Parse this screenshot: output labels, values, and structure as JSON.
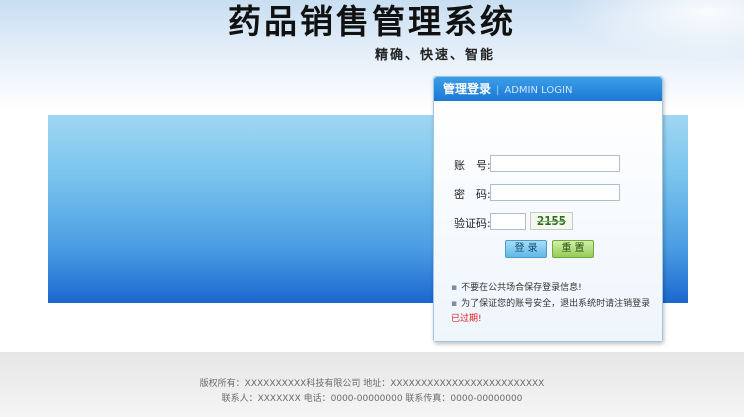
{
  "header": {
    "title": "药品销售管理系统",
    "slogan": "精确、快速、智能"
  },
  "login_panel": {
    "title": "管理登录",
    "separator": "|",
    "subtitle": "ADMIN LOGIN",
    "account_label": "账　号:",
    "account_value": "",
    "password_label": "密　码:",
    "password_value": "",
    "captcha_label": "验证码:",
    "captcha_value": "",
    "captcha_image_text": "2155",
    "login_button": "登录",
    "reset_button": "重置",
    "bullet": "▪",
    "notes": [
      "不要在公共场合保存登录信息!",
      "为了保证您的账号安全，退出系统时请注销登录"
    ],
    "expired_text": "已过期!"
  },
  "footer": {
    "line1": "版权所有：XXXXXXXXXX科技有限公司  地址：XXXXXXXXXXXXXXXXXXXXXXXXX",
    "line2": "联系人：XXXXXXX  电话：0000-00000000  联系传真：0000-00000000"
  },
  "colors": {
    "panel_header": "#1b78d4",
    "banner_top": "#9fd7f2",
    "banner_bottom": "#1b67cf",
    "login_button": "#5fb8e6",
    "reset_button": "#93cc57",
    "expired": "#e01c1c"
  }
}
